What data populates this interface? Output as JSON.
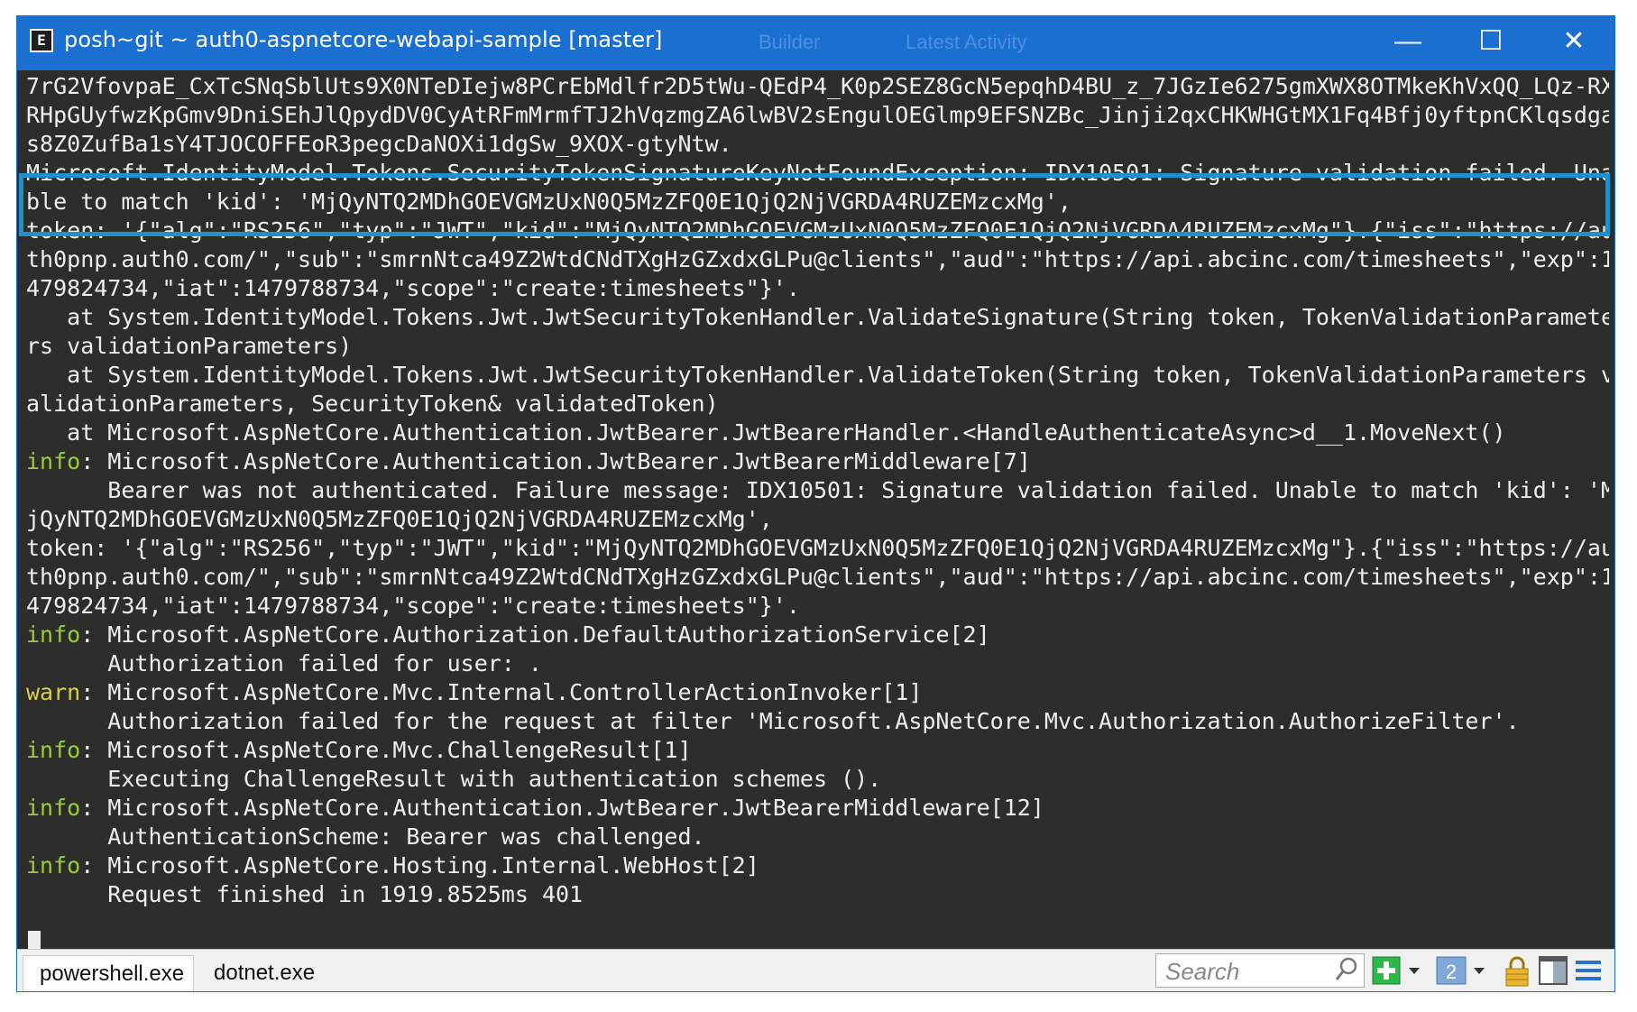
{
  "window": {
    "title": "posh~git ~ auth0-aspnetcore-webapi-sample [master]",
    "app_icon_glyph": "E",
    "ghost_title_1": "Builder",
    "ghost_title_2": "Latest Activity"
  },
  "controls": {
    "minimize": "—",
    "maximize": "☐",
    "close": "✕"
  },
  "console": {
    "lines": [
      {
        "prefix": "",
        "text": "7rG2VfovpaE_CxTcSNqSblUts9X0NTeDIejw8PCrEbMdlfr2D5tWu-QEdP4_K0p2SEZ8GcN5epqhD4BU_z_7JGzIe6275gmXWX8OTMkeKhVxQQ_LQz-RX"
      },
      {
        "prefix": "",
        "text": "RHpGUyfwzKpGmv9DniSEhJlQpydDV0CyAtRFmMrmfTJ2hVqzmgZA6lwBV2sEngulOEGlmp9EFSNZBc_Jinji2qxCHKWHGtMX1Fq4Bfj0yftpnCKlqsdga"
      },
      {
        "prefix": "",
        "text": "s8Z0ZufBa1sY4TJOCOFFEoR3pegcDaNOXi1dgSw_9XOX-gtyNtw."
      },
      {
        "prefix": "",
        "text": "Microsoft.IdentityModel.Tokens.SecurityTokenSignatureKeyNotFoundException: IDX10501: Signature validation failed. Una"
      },
      {
        "prefix": "",
        "text": "ble to match 'kid': 'MjQyNTQ2MDhGOEVGMzUxN0Q5MzZFQ0E1QjQ2NjVGRDA4RUZEMzcxMg',"
      },
      {
        "prefix": "",
        "text": "token: '{\"alg\":\"RS256\",\"typ\":\"JWT\",\"kid\":\"MjQyNTQ2MDhGOEVGMzUxN0Q5MzZFQ0E1QjQ2NjVGRDA4RUZEMzcxMg\"}.{\"iss\":\"https://au"
      },
      {
        "prefix": "",
        "text": "th0pnp.auth0.com/\",\"sub\":\"smrnNtca49Z2WtdCNdTXgHzGZxdxGLPu@clients\",\"aud\":\"https://api.abcinc.com/timesheets\",\"exp\":1"
      },
      {
        "prefix": "",
        "text": "479824734,\"iat\":1479788734,\"scope\":\"create:timesheets\"}'."
      },
      {
        "prefix": "",
        "text": "   at System.IdentityModel.Tokens.Jwt.JwtSecurityTokenHandler.ValidateSignature(String token, TokenValidationParamete"
      },
      {
        "prefix": "",
        "text": "rs validationParameters)"
      },
      {
        "prefix": "",
        "text": "   at System.IdentityModel.Tokens.Jwt.JwtSecurityTokenHandler.ValidateToken(String token, TokenValidationParameters v"
      },
      {
        "prefix": "",
        "text": "alidationParameters, SecurityToken& validatedToken)"
      },
      {
        "prefix": "",
        "text": "   at Microsoft.AspNetCore.Authentication.JwtBearer.JwtBearerHandler.<HandleAuthenticateAsync>d__1.MoveNext()"
      },
      {
        "prefix": "info",
        "text": ": Microsoft.AspNetCore.Authentication.JwtBearer.JwtBearerMiddleware[7]"
      },
      {
        "prefix": "",
        "text": "      Bearer was not authenticated. Failure message: IDX10501: Signature validation failed. Unable to match 'kid': 'M"
      },
      {
        "prefix": "",
        "text": "jQyNTQ2MDhGOEVGMzUxN0Q5MzZFQ0E1QjQ2NjVGRDA4RUZEMzcxMg',"
      },
      {
        "prefix": "",
        "text": "token: '{\"alg\":\"RS256\",\"typ\":\"JWT\",\"kid\":\"MjQyNTQ2MDhGOEVGMzUxN0Q5MzZFQ0E1QjQ2NjVGRDA4RUZEMzcxMg\"}.{\"iss\":\"https://au"
      },
      {
        "prefix": "",
        "text": "th0pnp.auth0.com/\",\"sub\":\"smrnNtca49Z2WtdCNdTXgHzGZxdxGLPu@clients\",\"aud\":\"https://api.abcinc.com/timesheets\",\"exp\":1"
      },
      {
        "prefix": "",
        "text": "479824734,\"iat\":1479788734,\"scope\":\"create:timesheets\"}'."
      },
      {
        "prefix": "info",
        "text": ": Microsoft.AspNetCore.Authorization.DefaultAuthorizationService[2]"
      },
      {
        "prefix": "",
        "text": "      Authorization failed for user: ."
      },
      {
        "prefix": "warn",
        "text": ": Microsoft.AspNetCore.Mvc.Internal.ControllerActionInvoker[1]"
      },
      {
        "prefix": "",
        "text": "      Authorization failed for the request at filter 'Microsoft.AspNetCore.Mvc.Authorization.AuthorizeFilter'."
      },
      {
        "prefix": "info",
        "text": ": Microsoft.AspNetCore.Mvc.ChallengeResult[1]"
      },
      {
        "prefix": "",
        "text": "      Executing ChallengeResult with authentication schemes ()."
      },
      {
        "prefix": "info",
        "text": ": Microsoft.AspNetCore.Authentication.JwtBearer.JwtBearerMiddleware[12]"
      },
      {
        "prefix": "",
        "text": "      AuthenticationScheme: Bearer was challenged."
      },
      {
        "prefix": "info",
        "text": ": Microsoft.AspNetCore.Hosting.Internal.WebHost[2]"
      },
      {
        "prefix": "",
        "text": "      Request finished in 1919.8525ms 401"
      }
    ]
  },
  "statusbar": {
    "tabs": [
      "powershell.exe",
      "dotnet.exe"
    ],
    "search_placeholder": "Search",
    "search_icon": "search-icon",
    "tools": [
      "new-console-icon",
      "dropdown-arrow-icon",
      "console-number-icon",
      "dropdown-arrow-icon",
      "lock-icon",
      "split-view-icon",
      "menu-icon"
    ],
    "console_number": "2"
  },
  "colors": {
    "titlebar": "#1a6fd0",
    "console_bg": "#2d2d2b",
    "info": "#9acd32",
    "warn": "#d8d048",
    "highlight_border": "#1e90cc"
  }
}
